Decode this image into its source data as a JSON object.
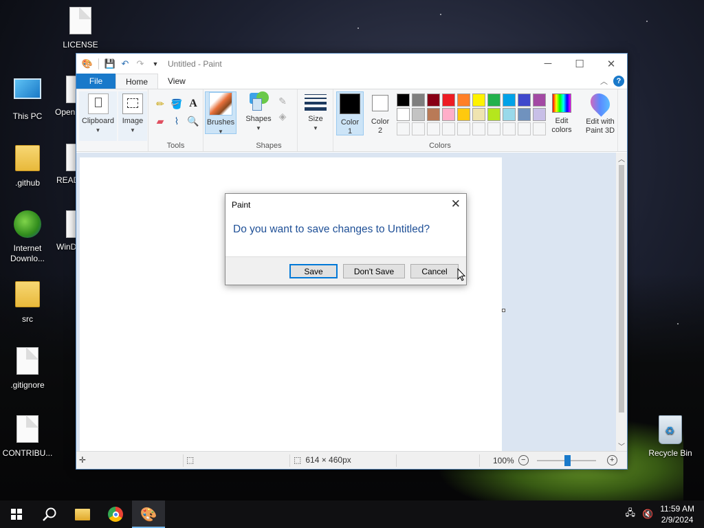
{
  "desktop": {
    "icons": [
      {
        "label": "LICENSE",
        "icon": "document-icon"
      },
      {
        "label": "This PC",
        "icon": "computer-icon"
      },
      {
        "label": "Open",
        "icon": "document-icon"
      },
      {
        "label": ".github",
        "icon": "folder-icon"
      },
      {
        "label": "READ",
        "icon": "document-icon"
      },
      {
        "label": "Internet Downlo...",
        "icon": "idm-icon"
      },
      {
        "label": "WinD",
        "icon": "document-icon"
      },
      {
        "label": "src",
        "icon": "folder-icon"
      },
      {
        "label": ".gitignore",
        "icon": "document-icon"
      },
      {
        "label": "CONTRIBU...",
        "icon": "document-icon"
      },
      {
        "label": "Recycle Bin",
        "icon": "recycle-bin-icon"
      }
    ]
  },
  "paint": {
    "title": "Untitled - Paint",
    "tabs": {
      "file": "File",
      "home": "Home",
      "view": "View"
    },
    "ribbon": {
      "clipboard": "Clipboard",
      "image": "Image",
      "tools_label": "Tools",
      "brushes": "Brushes",
      "shapes_btn": "Shapes",
      "shapes_label": "Shapes",
      "size": "Size",
      "color1": "Color 1",
      "color1_line1": "Color",
      "color1_line2": "1",
      "color2_line1": "Color",
      "color2_line2": "2",
      "colors_label": "Colors",
      "edit_colors_line1": "Edit",
      "edit_colors_line2": "colors",
      "paint3d_line1": "Edit with",
      "paint3d_line2": "Paint 3D"
    },
    "palette_row1": [
      "#000000",
      "#7f7f7f",
      "#880015",
      "#ed1c24",
      "#ff7f27",
      "#fff200",
      "#22b14c",
      "#00a2e8",
      "#3f48cc",
      "#a349a4"
    ],
    "palette_row2": [
      "#ffffff",
      "#c3c3c3",
      "#b97a57",
      "#ffaec9",
      "#ffc90e",
      "#efe4b0",
      "#b5e61d",
      "#99d9ea",
      "#7092be",
      "#c8bfe7"
    ],
    "status": {
      "canvas_size": "614 × 460px",
      "zoom": "100%"
    }
  },
  "dialog": {
    "title": "Paint",
    "message": "Do you want to save changes to Untitled?",
    "save": "Save",
    "dont_save": "Don't Save",
    "cancel": "Cancel"
  },
  "taskbar": {
    "time": "11:59 AM",
    "date": "2/9/2024"
  }
}
